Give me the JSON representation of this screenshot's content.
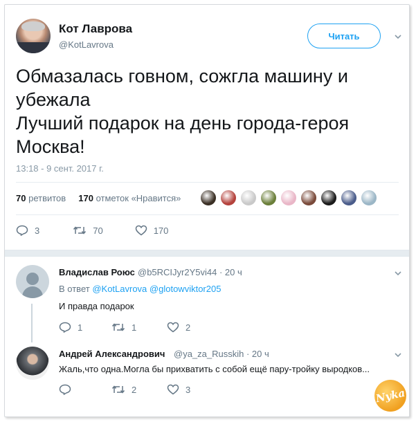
{
  "tweet": {
    "author_name": "Кот Лаврова",
    "author_handle": "@KotLavrova",
    "follow_label": "Читать",
    "text_lines": [
      "Обмазалась говном, сожгла машину и",
      "убежала",
      "Лучший подарок на день города-героя",
      "Москва!"
    ],
    "timestamp": "13:18 - 9 сент. 2017 г.",
    "retweets_count": "70",
    "retweets_label": "ретвитов",
    "likes_count": "170",
    "likes_label": "отметок «Нравится»",
    "liker_colors": [
      "#3a2f24",
      "#b4423c",
      "#c9c9c9",
      "#6b7f3a",
      "#e9b6c7",
      "#7a4a3a",
      "#1a1a1a",
      "#4a5c8a",
      "#9bb6c6"
    ],
    "actions": {
      "replies": "3",
      "retweets": "70",
      "likes": "170"
    }
  },
  "replies": [
    {
      "name": "Владислав Роюс",
      "handle": "@b5RCIJyr2Y5vi44",
      "time": "20 ч",
      "reply_prefix": "В ответ",
      "mentions": [
        "@KotLavrova",
        "@glotowviktor205"
      ],
      "text": "И правда подарок",
      "actions": {
        "replies": "1",
        "retweets": "1",
        "likes": "2"
      }
    },
    {
      "name": "Андрей Александрович",
      "handle": "@ya_za_Russkih",
      "time": "20 ч",
      "text": "Жаль,что одна.Могла бы прихватить с собой ещё пару-тройку выродков...",
      "actions": {
        "retweets": "2",
        "likes": "3"
      }
    }
  ],
  "watermark": "Nyka",
  "colors": {
    "accent": "#1da1f2",
    "muted": "#657786",
    "like": "#e0245e"
  }
}
